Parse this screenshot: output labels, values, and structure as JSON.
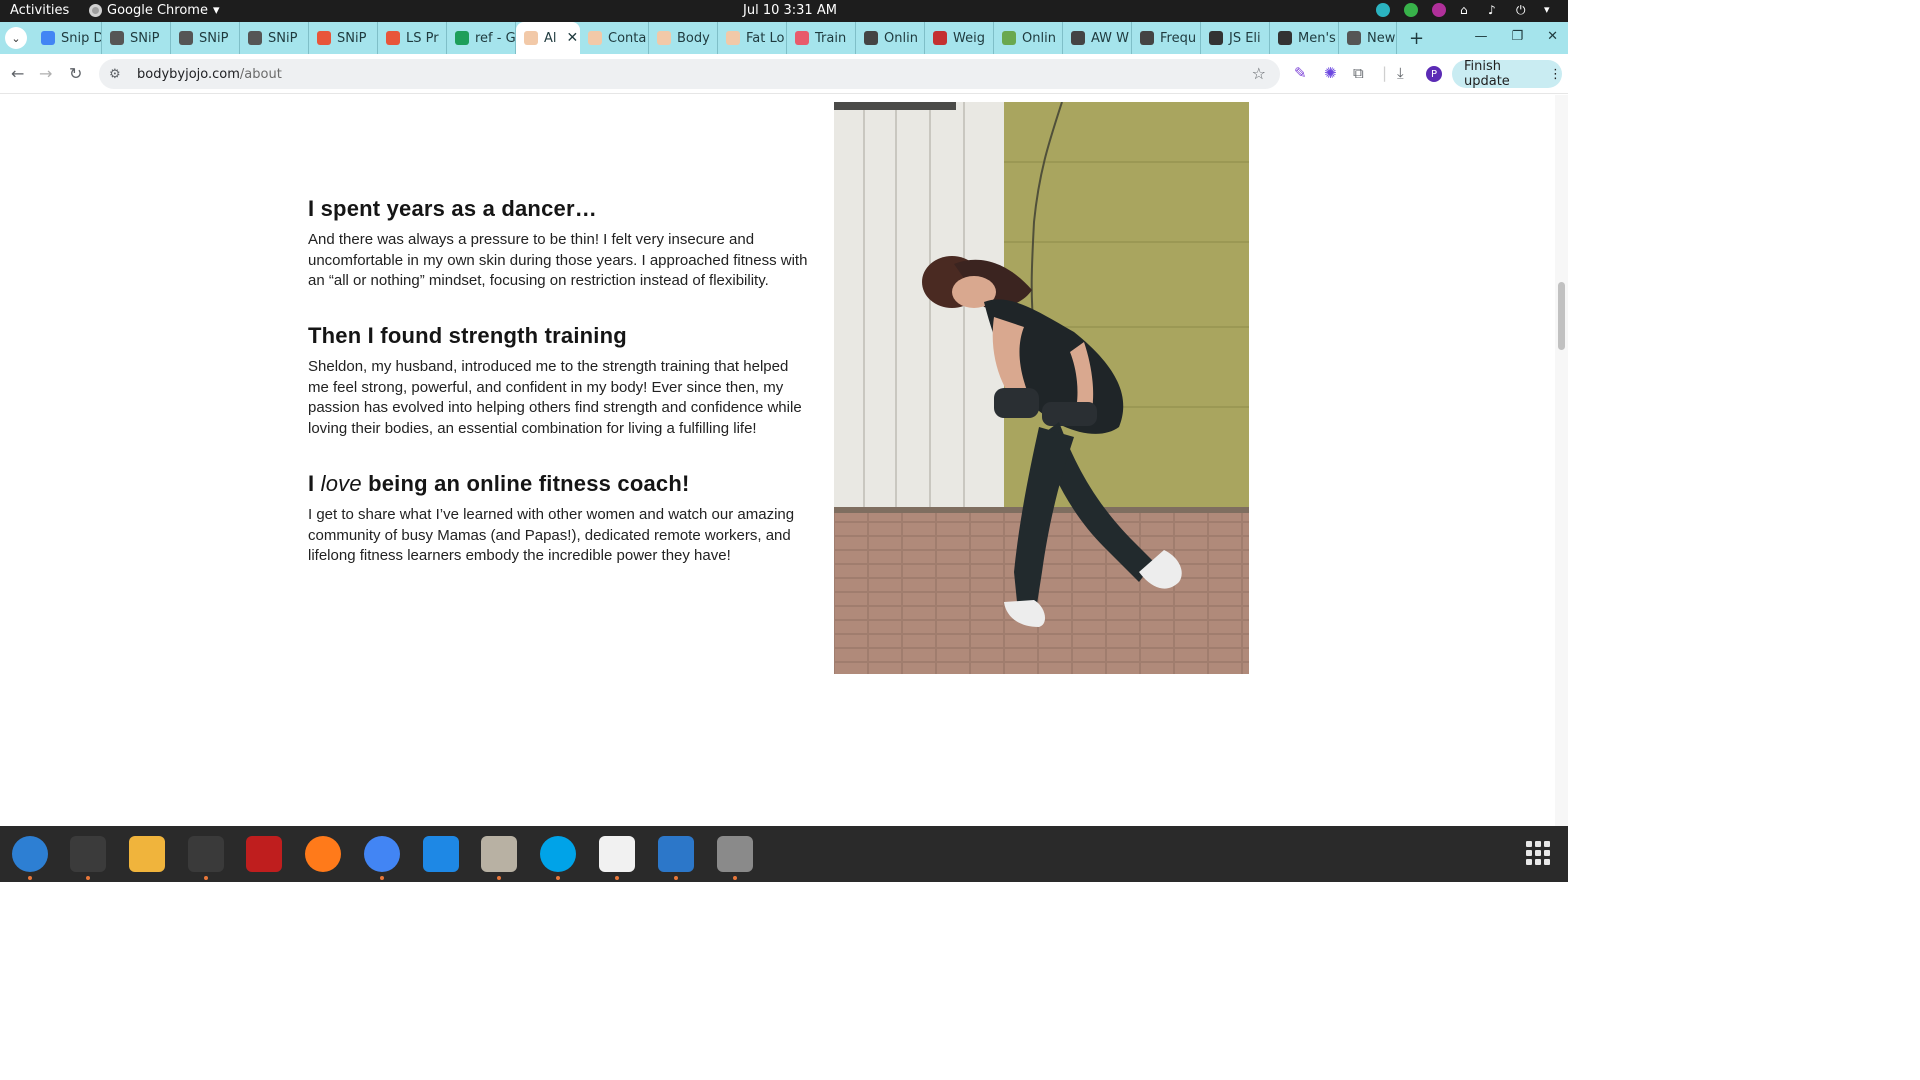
{
  "topbar": {
    "activities": "Activities",
    "app_name": "Google Chrome",
    "clock": "Jul 10  3:31 AM"
  },
  "tabs": [
    {
      "label": "Snip D",
      "color": "#4285f4"
    },
    {
      "label": "SNiP",
      "color": "#555555"
    },
    {
      "label": "SNiP",
      "color": "#555555"
    },
    {
      "label": "SNiP",
      "color": "#555555"
    },
    {
      "label": "SNiP",
      "color": "#e8553a"
    },
    {
      "label": "LS Pr",
      "color": "#e8553a"
    },
    {
      "label": "ref - G",
      "color": "#1e9e5a"
    },
    {
      "label": "Al",
      "color": "#f2c9a8",
      "active": true
    },
    {
      "label": "Conta",
      "color": "#f2c9a8"
    },
    {
      "label": "Body",
      "color": "#f2c9a8"
    },
    {
      "label": "Fat Lo",
      "color": "#f2c9a8"
    },
    {
      "label": "Train",
      "color": "#e85a6b"
    },
    {
      "label": "Onlin",
      "color": "#444444"
    },
    {
      "label": "Weig",
      "color": "#c43030"
    },
    {
      "label": "Onlin",
      "color": "#6aa84f"
    },
    {
      "label": "AW W",
      "color": "#444444"
    },
    {
      "label": "Frequ",
      "color": "#444444"
    },
    {
      "label": "JS Eli",
      "color": "#333333"
    },
    {
      "label": "Men's",
      "color": "#333333"
    },
    {
      "label": "New",
      "color": "#555555"
    }
  ],
  "address": {
    "domain": "bodybyjojo.com",
    "path": "/about"
  },
  "toolbar": {
    "finish_update": "Finish update",
    "avatar_letter": "P"
  },
  "article": {
    "h1": "I spent years as a dancer…",
    "p1": "And there was always a pressure to be thin! I felt very insecure and uncomfortable in my own skin during those years. I approached fitness with an “all or nothing” mindset, focusing on restriction instead of flexibility.",
    "h2": "Then I found strength training",
    "p2": "Sheldon, my husband, introduced me to the strength training that helped me feel strong, powerful, and confident in my body! Ever since then, my passion has evolved into helping others find strength and confidence while loving their bodies, an essential combination for living a fulfilling life!",
    "h3_pre": "I ",
    "h3_em": "love",
    "h3_post": " being an online fitness coach!",
    "p3": "I get to share what I’ve learned with other women and watch our amazing community of busy Mamas (and Papas!), dedicated remote workers, and lifelong fitness learners embody the incredible power they have!"
  },
  "dock": [
    {
      "name": "thunderbird",
      "color": "#2d7fd3"
    },
    {
      "name": "terminal",
      "color": "#3b3b3b"
    },
    {
      "name": "calculator",
      "color": "#f0b43c"
    },
    {
      "name": "system-monitor",
      "color": "#3a3a3a"
    },
    {
      "name": "filezilla",
      "color": "#bf1e1e"
    },
    {
      "name": "firefox",
      "color": "#ff7a1a"
    },
    {
      "name": "chrome",
      "color": "#4285f4"
    },
    {
      "name": "vscode",
      "color": "#1e88e5"
    },
    {
      "name": "files",
      "color": "#b8b1a3"
    },
    {
      "name": "skype",
      "color": "#00a3e8"
    },
    {
      "name": "text-editor",
      "color": "#f1f1f1"
    },
    {
      "name": "libreoffice-impress",
      "color": "#2c77c9"
    },
    {
      "name": "disk-utility",
      "color": "#8a8a8a"
    }
  ]
}
